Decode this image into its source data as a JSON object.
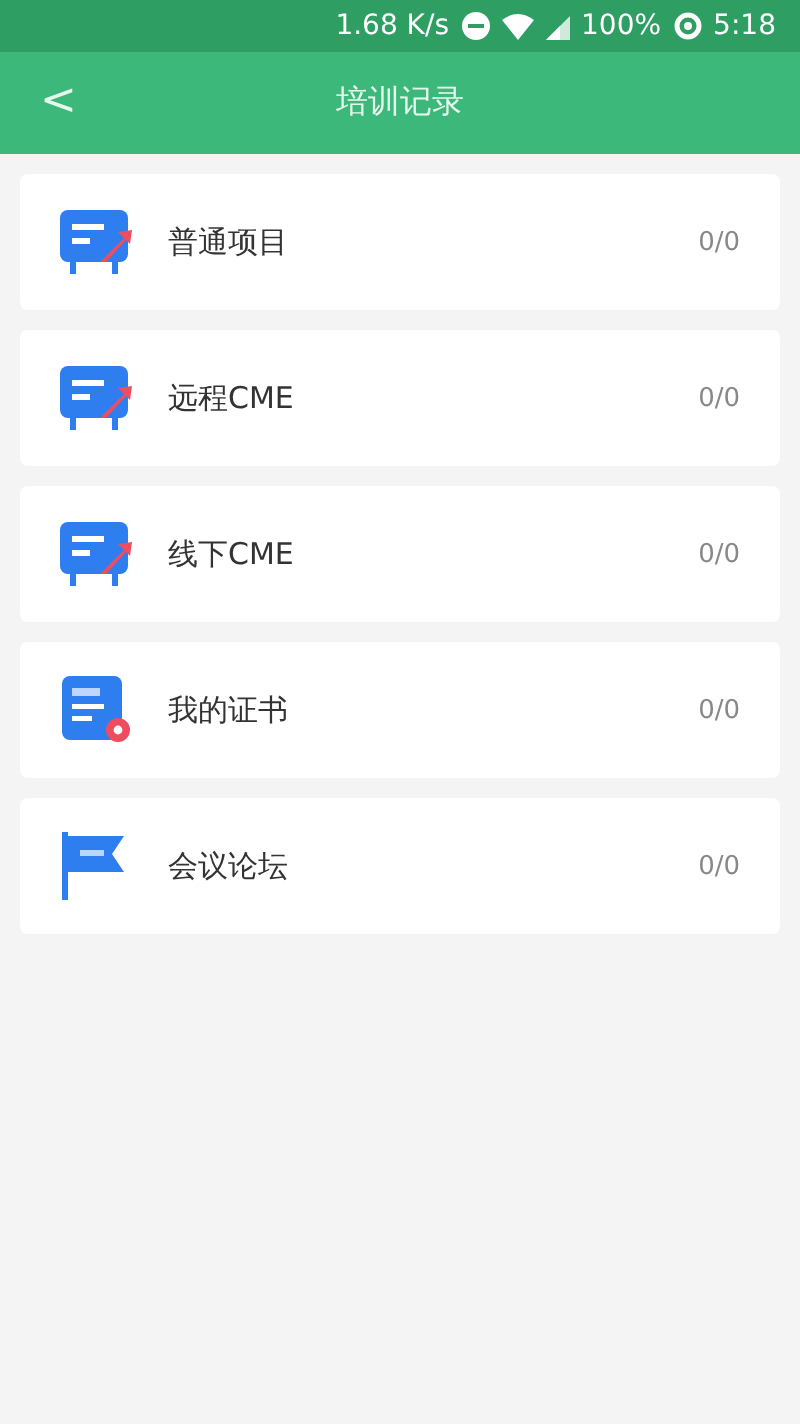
{
  "status_bar": {
    "speed": "1.68 K/s",
    "battery": "100%",
    "time": "5:18"
  },
  "header": {
    "back": "<",
    "title": "培训记录"
  },
  "items": [
    {
      "kind": "board",
      "label": "普通项目",
      "count": "0/0"
    },
    {
      "kind": "board",
      "label": "远程CME",
      "count": "0/0"
    },
    {
      "kind": "board",
      "label": "线下CME",
      "count": "0/0"
    },
    {
      "kind": "certificate",
      "label": "我的证书",
      "count": "0/0"
    },
    {
      "kind": "flag",
      "label": "会议论坛",
      "count": "0/0"
    }
  ]
}
